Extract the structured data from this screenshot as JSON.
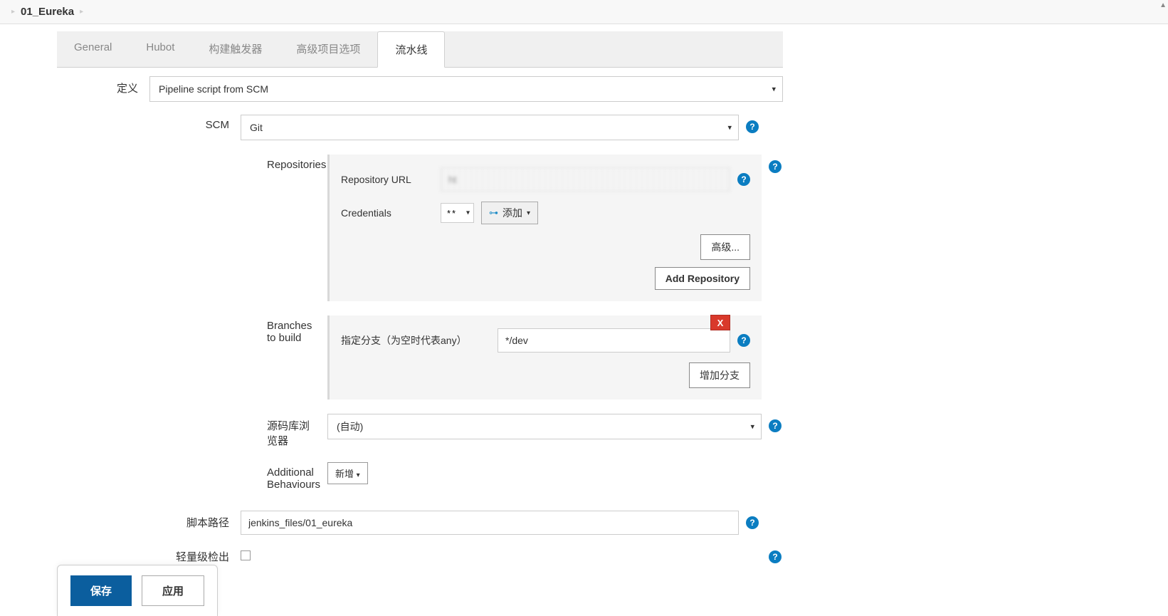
{
  "breadcrumb": {
    "item": "01_Eureka"
  },
  "tabs": [
    "General",
    "Hubot",
    "构建触发器",
    "高级项目选项",
    "流水线"
  ],
  "active_tab_index": 4,
  "form": {
    "definition": {
      "label": "定义",
      "value": "Pipeline script from SCM"
    },
    "scm": {
      "label": "SCM",
      "value": "Git"
    },
    "repositories": {
      "label": "Repositories",
      "repo_url_label": "Repository URL",
      "repo_url_value": "ht",
      "credentials_label": "Credentials",
      "credentials_value": "**",
      "add_label": "添加",
      "advanced_label": "高级...",
      "add_repo_label": "Add Repository"
    },
    "branches": {
      "label": "Branches to build",
      "branch_label": "指定分支（为空时代表any）",
      "branch_value": "*/dev",
      "add_branch_label": "增加分支",
      "delete_label": "X"
    },
    "browser": {
      "label": "源码库浏览器",
      "value": "(自动)"
    },
    "behaviours": {
      "label": "Additional Behaviours",
      "add_label": "新增"
    },
    "script_path": {
      "label": "脚本路径",
      "value": "jenkins_files/01_eureka"
    },
    "lightweight": {
      "label": "轻量级检出"
    }
  },
  "buttons": {
    "save": "保存",
    "apply": "应用"
  },
  "help": "?"
}
